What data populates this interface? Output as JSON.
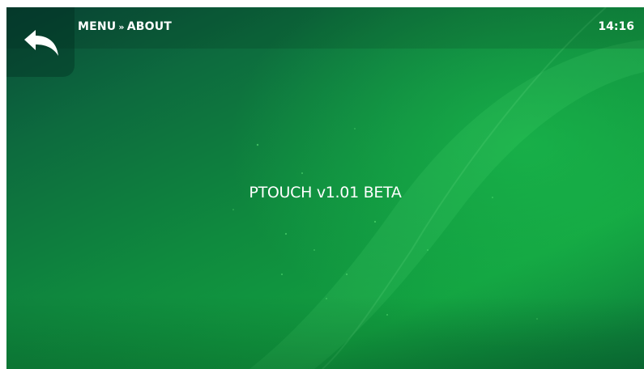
{
  "header": {
    "breadcrumb": [
      "MENU",
      "ABOUT"
    ],
    "breadcrumb_separator": "»",
    "time": "14:16"
  },
  "back_button": {
    "icon": "back-arrow-icon"
  },
  "main": {
    "version_text": "PTOUCH v1.01 BETA"
  },
  "colors": {
    "background_dark": "#0a4a3a",
    "background_mid": "#0f8a3e",
    "background_light": "#12a040",
    "text": "#ffffff"
  }
}
